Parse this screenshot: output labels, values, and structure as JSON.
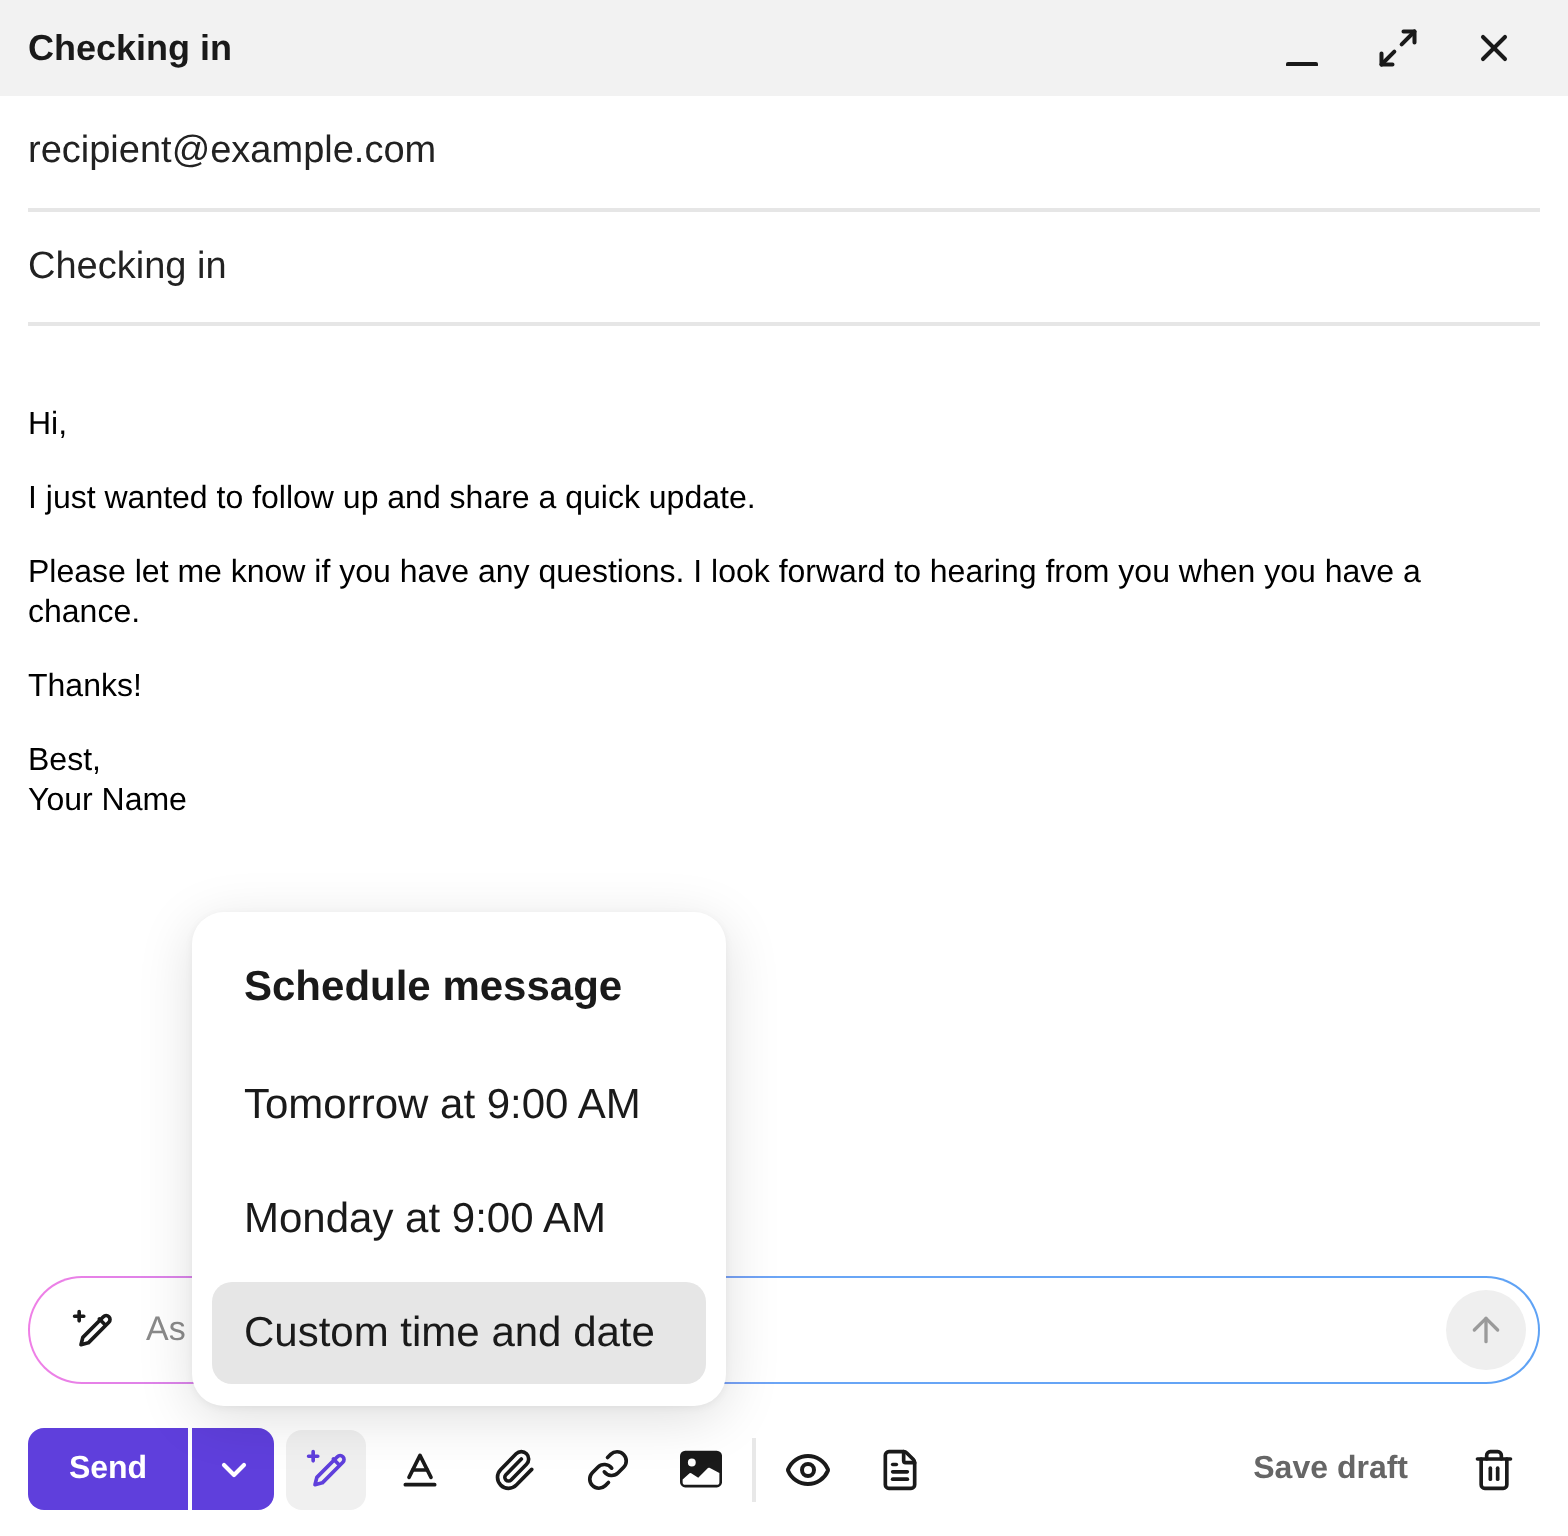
{
  "window": {
    "title": "Checking in"
  },
  "recipient": {
    "value": "recipient@example.com"
  },
  "subject": {
    "value": "Checking in"
  },
  "body": {
    "paragraphs": [
      "Hi,",
      "I just wanted to follow up and share a quick update.",
      "Please let me know if you have any questions. I look forward to hearing from you when you have a chance.",
      "Thanks!",
      "Best,\nYour Name"
    ]
  },
  "schedule_menu": {
    "title": "Schedule message",
    "items": [
      {
        "label": "Tomorrow at 9:00 AM",
        "highlighted": false
      },
      {
        "label": "Monday at 9:00 AM",
        "highlighted": false
      },
      {
        "label": "Custom time and date",
        "highlighted": true
      }
    ]
  },
  "ai_prompt": {
    "placeholder": "As"
  },
  "toolbar": {
    "send_label": "Send",
    "ai_assist": {
      "active": true
    },
    "save_draft_label": "Save draft"
  }
}
